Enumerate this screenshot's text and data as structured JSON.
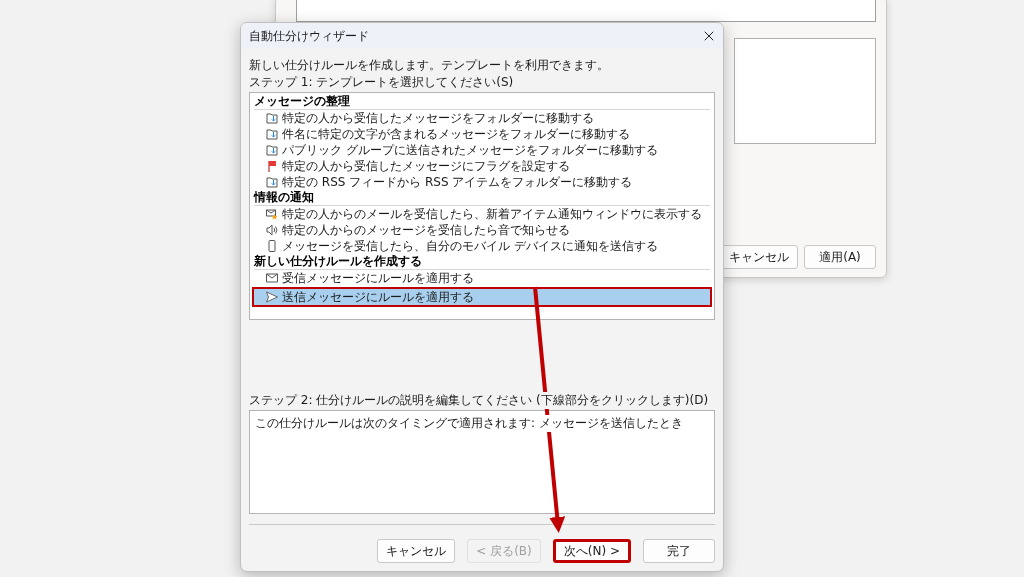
{
  "background_window": {
    "buttons": [
      {
        "label": "キャンセル"
      },
      {
        "label": "適用(A)"
      }
    ]
  },
  "dialog": {
    "title": "自動仕分けウィザード",
    "intro": "新しい仕分けルールを作成します。テンプレートを利用できます。",
    "step1_label": "ステップ 1: テンプレートを選択してください(S)",
    "template_groups": [
      {
        "heading": "メッセージの整理",
        "items": [
          {
            "label": "特定の人から受信したメッセージをフォルダーに移動する",
            "kind": "move",
            "selected": false,
            "highlighted": false
          },
          {
            "label": "件名に特定の文字が含まれるメッセージをフォルダーに移動する",
            "kind": "move",
            "selected": false,
            "highlighted": false
          },
          {
            "label": "パブリック グループに送信されたメッセージをフォルダーに移動する",
            "kind": "move",
            "selected": false,
            "highlighted": false
          },
          {
            "label": "特定の人から受信したメッセージにフラグを設定する",
            "kind": "flag",
            "selected": false,
            "highlighted": false
          },
          {
            "label": "特定の RSS フィードから RSS アイテムをフォルダーに移動する",
            "kind": "move",
            "selected": false,
            "highlighted": false
          }
        ]
      },
      {
        "heading": "情報の通知",
        "items": [
          {
            "label": "特定の人からのメールを受信したら、新着アイテム通知ウィンドウに表示する",
            "kind": "alert",
            "selected": false,
            "highlighted": false
          },
          {
            "label": "特定の人からのメッセージを受信したら音で知らせる",
            "kind": "sound",
            "selected": false,
            "highlighted": false
          },
          {
            "label": "メッセージを受信したら、自分のモバイル デバイスに通知を送信する",
            "kind": "mobile",
            "selected": false,
            "highlighted": false
          }
        ]
      },
      {
        "heading": "新しい仕分けルールを作成する",
        "items": [
          {
            "label": "受信メッセージにルールを適用する",
            "kind": "mail",
            "selected": false,
            "highlighted": false
          },
          {
            "label": "送信メッセージにルールを適用する",
            "kind": "send",
            "selected": true,
            "highlighted": true
          }
        ]
      }
    ],
    "step2_label": "ステップ 2: 仕分けルールの説明を編集してください (下線部分をクリックします)(D)",
    "description": "この仕分けルールは次のタイミングで適用されます: メッセージを送信したとき",
    "buttons": [
      {
        "label": "キャンセル",
        "disabled": false,
        "highlighted": false
      },
      {
        "label": "< 戻る(B)",
        "disabled": true,
        "highlighted": false
      },
      {
        "label": "次へ(N) >",
        "disabled": false,
        "highlighted": true
      },
      {
        "label": "完了",
        "disabled": false,
        "highlighted": false
      }
    ]
  }
}
